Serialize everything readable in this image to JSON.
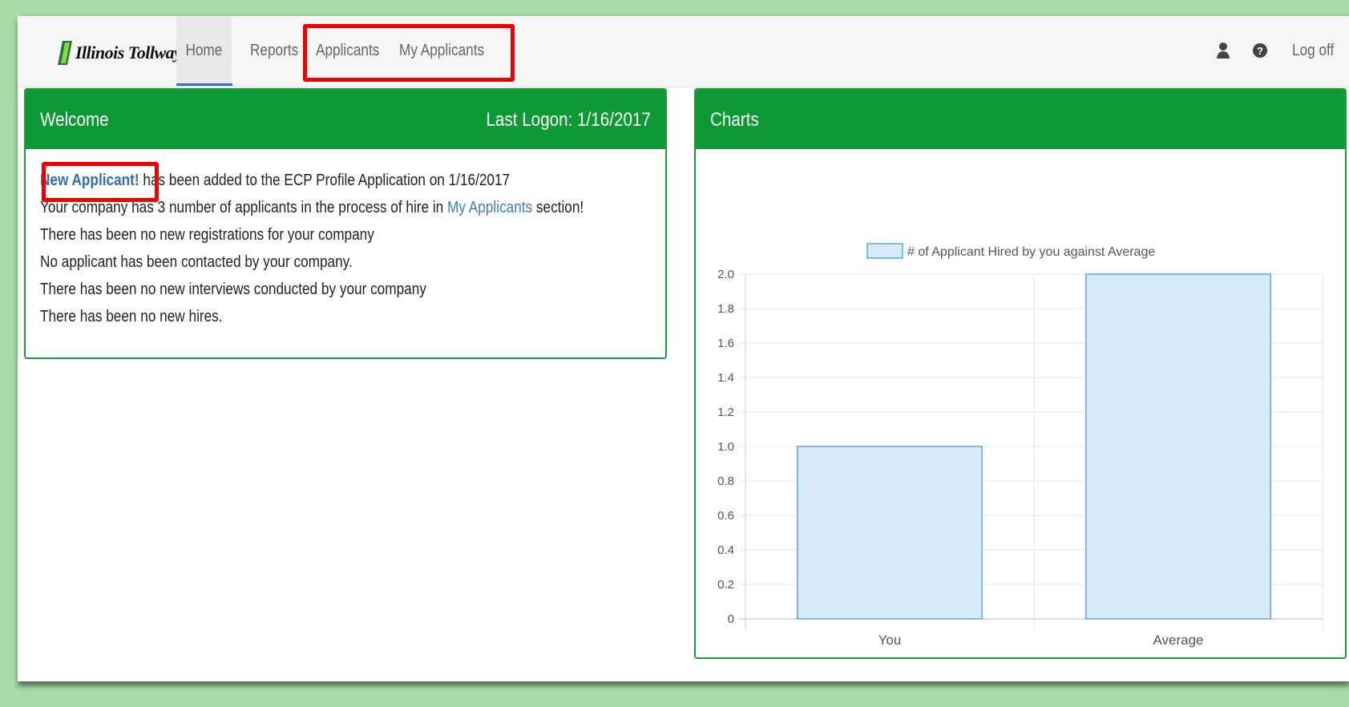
{
  "navbar": {
    "logo_text": "Illinois Tollway",
    "items": [
      {
        "label": "Home"
      },
      {
        "label": "Reports"
      },
      {
        "label": "Applicants"
      },
      {
        "label": "My Applicants"
      }
    ],
    "user_icon": "user-icon",
    "help_icon": "help-circle-icon",
    "logoff_label": "Log off"
  },
  "welcome": {
    "title": "Welcome",
    "last_logon": "Last Logon: 1/16/2017",
    "line1_link": "New Applicant!",
    "line1_text": " has been added to the ECP Profile Application on 1/16/2017",
    "line2_pre": "Your company has 3 number of applicants in the process of hire in ",
    "line2_link": "My Applicants",
    "line2_post": " section!",
    "line3": "There has been no new registrations for your company",
    "line4": "No applicant has been contacted by your company.",
    "line5": "There has been no new interviews conducted by your company",
    "line6": "There has been no new hires."
  },
  "charts_panel": {
    "title": "Charts"
  },
  "chart_data": {
    "type": "bar",
    "categories": [
      "You",
      "Average"
    ],
    "series": [
      {
        "name": "# of Applicant Hired by you against Average",
        "values": [
          1.0,
          2.0
        ]
      }
    ],
    "ylim": [
      0,
      2.0
    ],
    "yticks": [
      "0",
      "0.2",
      "0.4",
      "0.6",
      "0.8",
      "1.0",
      "1.2",
      "1.4",
      "1.6",
      "1.8",
      "2.0"
    ],
    "grid": true,
    "legend": "top-center",
    "colors": {
      "bar_fill": "#d6e9f8",
      "bar_stroke": "#5aa9e0"
    }
  },
  "colors": {
    "panel_header": "#0d9a34",
    "link": "#3b7bc4",
    "highlight": "#ee0000"
  }
}
